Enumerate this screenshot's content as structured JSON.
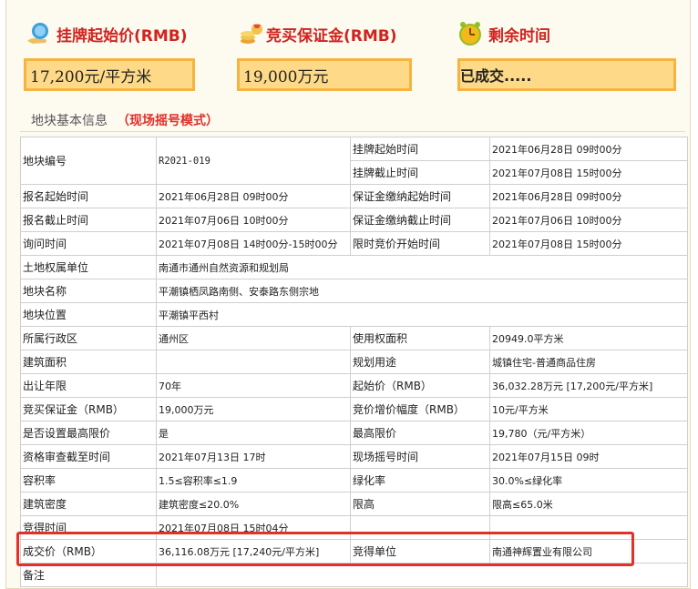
{
  "stats": {
    "start_price": {
      "label": "挂牌起始价(RMB)",
      "value": "17,200元/平方米",
      "icon": "hand-coin-icon"
    },
    "deposit": {
      "label": "竞买保证金(RMB)",
      "value": "19,000万元",
      "icon": "coin-stack-icon"
    },
    "remaining": {
      "label": "剩余时间",
      "value": "已成交.....",
      "icon": "alarm-clock-icon"
    }
  },
  "section": {
    "title": "地块基本信息",
    "mode": "（现场摇号模式）"
  },
  "table": {
    "r0": {
      "l1": "地块编号",
      "v1": "R2021-019",
      "l2a": "挂牌起始时间",
      "v2a": "2021年06月28日 09时00分",
      "l2b": "挂牌截止时间",
      "v2b": "2021年07月08日 15时00分"
    },
    "r1": {
      "l1": "报名起始时间",
      "v1": "2021年06月28日 09时00分",
      "l2": "保证金缴纳起始时间",
      "v2": "2021年06月28日 09时00分"
    },
    "r2": {
      "l1": "报名截止时间",
      "v1": "2021年07月06日 10时00分",
      "l2": "保证金缴纳截止时间",
      "v2": "2021年07月06日 10时00分"
    },
    "r3": {
      "l1": "询问时间",
      "v1": "2021年07月08日 14时00分-15时00分",
      "l2": "限时竞价开始时间",
      "v2": "2021年07月08日 15时00分"
    },
    "r4": {
      "l1": "土地权属单位",
      "v1": "南通市通州自然资源和规划局"
    },
    "r5": {
      "l1": "地块名称",
      "v1": "平潮镇栖凤路南侧、安泰路东侧宗地"
    },
    "r6": {
      "l1": "地块位置",
      "v1": "平潮镇平西村"
    },
    "r7": {
      "l1": "所属行政区",
      "v1": "通州区",
      "l2": "使用权面积",
      "v2": "20949.0平方米"
    },
    "r8": {
      "l1": "建筑面积",
      "v1": "",
      "l2": "规划用途",
      "v2": "城镇住宅-普通商品住房"
    },
    "r9": {
      "l1": "出让年限",
      "v1": "70年",
      "l2": "起始价（RMB）",
      "v2": "36,032.28万元 [17,200元/平方米]"
    },
    "r10": {
      "l1": "竞买保证金（RMB）",
      "v1": "19,000万元",
      "l2": "竞价增价幅度（RMB）",
      "v2": "10元/平方米"
    },
    "r11": {
      "l1": "是否设置最高限价",
      "v1": "是",
      "l2": "最高限价",
      "v2": "19,780（元/平方米）"
    },
    "r12": {
      "l1": "资格审查截至时间",
      "v1": "2021年07月13日 17时",
      "l2": "现场摇号时间",
      "v2": "2021年07月15日 09时"
    },
    "r13": {
      "l1": "容积率",
      "v1": "1.5≤容积率≤1.9",
      "l2": "绿化率",
      "v2": "30.0%≤绿化率"
    },
    "r14": {
      "l1": "建筑密度",
      "v1": "建筑密度≤20.0%",
      "l2": "限高",
      "v2": "限高≤65.0米"
    },
    "r15": {
      "l1": "竞得时间",
      "v1": "2021年07月08日 15时04分",
      "l2": "",
      "v2": ""
    },
    "r16": {
      "l1": "成交价（RMB）",
      "v1": "36,116.08万元 [17,240元/平方米]",
      "l2": "竞得单位",
      "v2": "南通神辉置业有限公司"
    },
    "r17": {
      "l1": "备注",
      "v1": ""
    }
  },
  "colors": {
    "accent_red": "#d0241f",
    "box_fill": "#fdd988",
    "box_border": "#f5b441",
    "highlight": "#e2302b"
  }
}
